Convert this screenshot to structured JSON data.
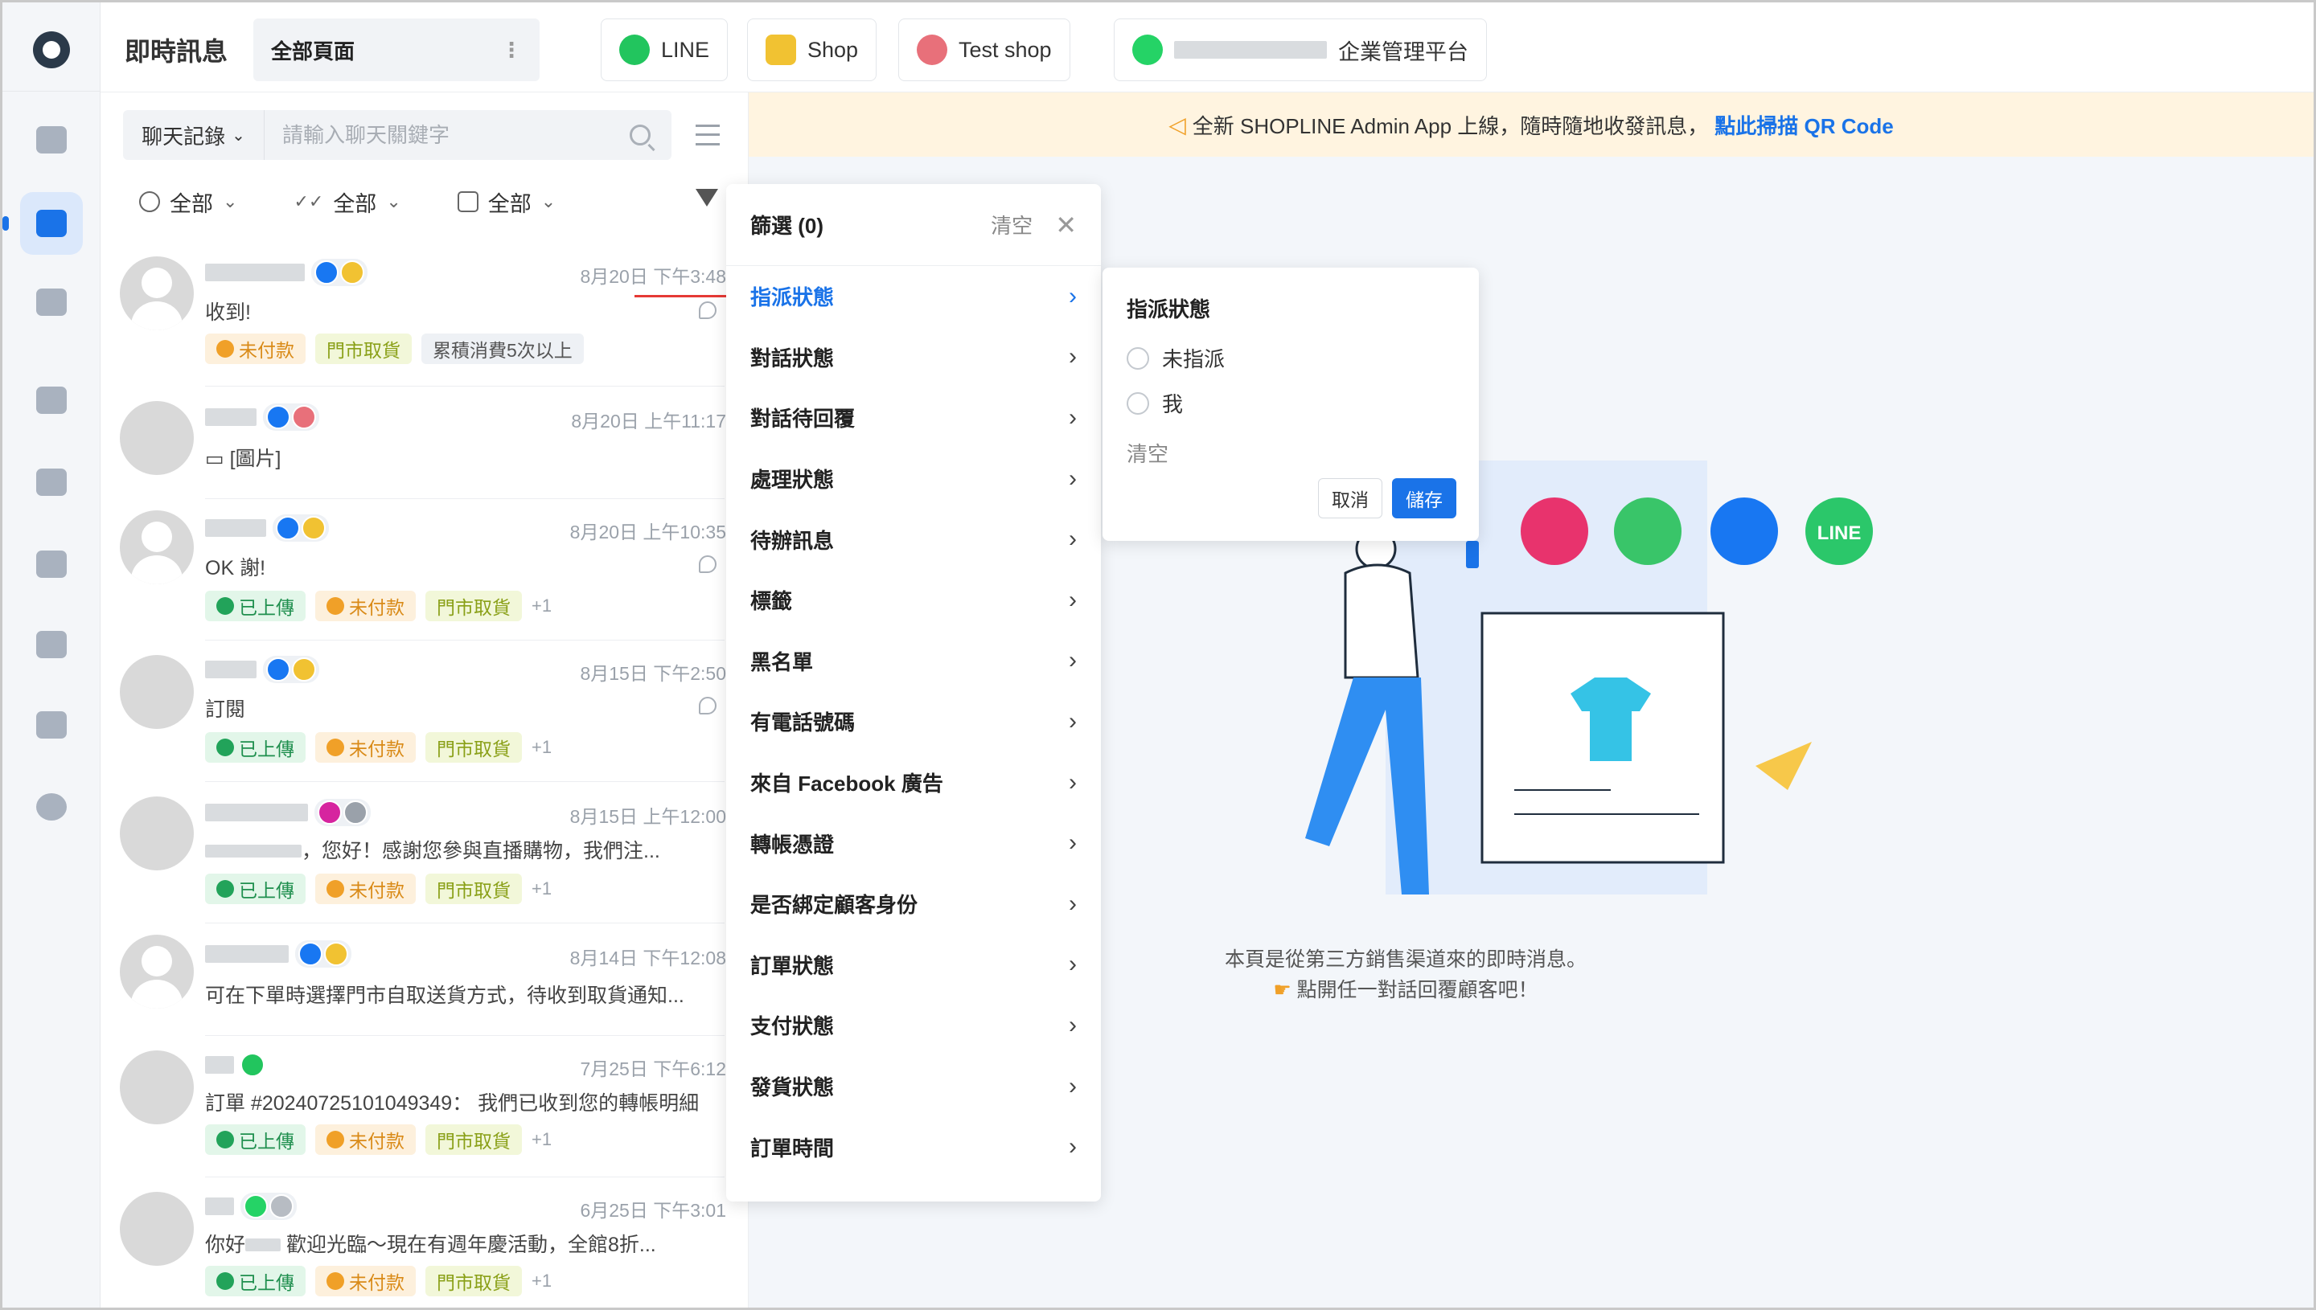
{
  "header": {
    "app_title": "即時訊息",
    "all_pages": "全部頁面",
    "tabs": [
      {
        "label": "LINE",
        "icon": "line-icon"
      },
      {
        "label": "Shop",
        "icon": "shop-icon"
      },
      {
        "label": "Test shop",
        "icon": "test-shop-icon"
      },
      {
        "label": "企業管理平台",
        "icon": "whatsapp-icon"
      }
    ]
  },
  "banner": {
    "text": "全新 SHOPLINE Admin App 上線，隨時隨地收發訊息，",
    "link": "點此掃描 QR Code"
  },
  "search": {
    "select_label": "聊天記錄",
    "placeholder": "請輸入聊天關鍵字"
  },
  "filters": [
    {
      "label": "全部",
      "icon": "user-icon"
    },
    {
      "label": "全部",
      "icon": "read-icon"
    },
    {
      "label": "全部",
      "icon": "task-icon"
    }
  ],
  "conversations": [
    {
      "time": "8月20日 下午3:48",
      "message": "收到!",
      "tags": [
        {
          "type": "unpaid",
          "label": "未付款"
        },
        {
          "type": "store",
          "label": "門市取貨"
        },
        {
          "type": "grey",
          "label": "累積消費5次以上"
        }
      ],
      "more": ""
    },
    {
      "time": "8月20日 上午11:17",
      "message": "[圖片]",
      "tags": [],
      "more": ""
    },
    {
      "time": "8月20日 上午10:35",
      "message": "OK 謝!",
      "tags": [
        {
          "type": "up",
          "label": "已上傳"
        },
        {
          "type": "unpaid",
          "label": "未付款"
        },
        {
          "type": "store",
          "label": "門市取貨"
        }
      ],
      "more": "+1"
    },
    {
      "time": "8月15日 下午2:50",
      "message": "訂閱",
      "tags": [
        {
          "type": "up",
          "label": "已上傳"
        },
        {
          "type": "unpaid",
          "label": "未付款"
        },
        {
          "type": "store",
          "label": "門市取貨"
        }
      ],
      "more": "+1"
    },
    {
      "time": "8月15日 上午12:00",
      "message": "，您好！感謝您參與直播購物，我們注...",
      "tags": [
        {
          "type": "up",
          "label": "已上傳"
        },
        {
          "type": "unpaid",
          "label": "未付款"
        },
        {
          "type": "store",
          "label": "門市取貨"
        }
      ],
      "more": "+1"
    },
    {
      "time": "8月14日 下午12:08",
      "message": "可在下單時選擇門市自取送貨方式，待收到取貨通知...",
      "tags": [],
      "more": ""
    },
    {
      "time": "7月25日 下午6:12",
      "message": "訂單 #20240725101049349： 我們已收到您的轉帳明細",
      "tags": [
        {
          "type": "up",
          "label": "已上傳"
        },
        {
          "type": "unpaid",
          "label": "未付款"
        },
        {
          "type": "store",
          "label": "門市取貨"
        }
      ],
      "more": "+1"
    },
    {
      "time": "6月25日 下午3:01",
      "message": "歡迎光臨～現在有週年慶活動，全館8折...",
      "prefix": "你好",
      "tags": [
        {
          "type": "up",
          "label": "已上傳"
        },
        {
          "type": "unpaid",
          "label": "未付款"
        },
        {
          "type": "store",
          "label": "門市取貨"
        }
      ],
      "more": "+1"
    }
  ],
  "filter_dropdown": {
    "title": "篩選 (0)",
    "clear": "清空",
    "items": [
      "指派狀態",
      "對話狀態",
      "對話待回覆",
      "處理狀態",
      "待辦訊息",
      "標籤",
      "黑名單",
      "有電話號碼",
      "來自 Facebook 廣告",
      "轉帳憑證",
      "是否綁定顧客身份",
      "訂單狀態",
      "支付狀態",
      "發貨狀態",
      "訂單時間"
    ],
    "selected": "指派狀態"
  },
  "submenu": {
    "title": "指派狀態",
    "options": [
      "未指派",
      "我"
    ],
    "clear": "清空",
    "cancel": "取消",
    "save": "儲存"
  },
  "main": {
    "hint_line1": "本頁是從第三方銷售渠道來的即時消息。",
    "hint_line2": "點開任一對話回覆顧客吧！"
  },
  "illustration_labels": {
    "line": "LINE"
  },
  "colors": {
    "accent": "#1a73e8",
    "banner_bg": "#fff4e0",
    "uploaded": "#22a35a",
    "unpaid": "#f0a028",
    "store": "#8aa018"
  }
}
